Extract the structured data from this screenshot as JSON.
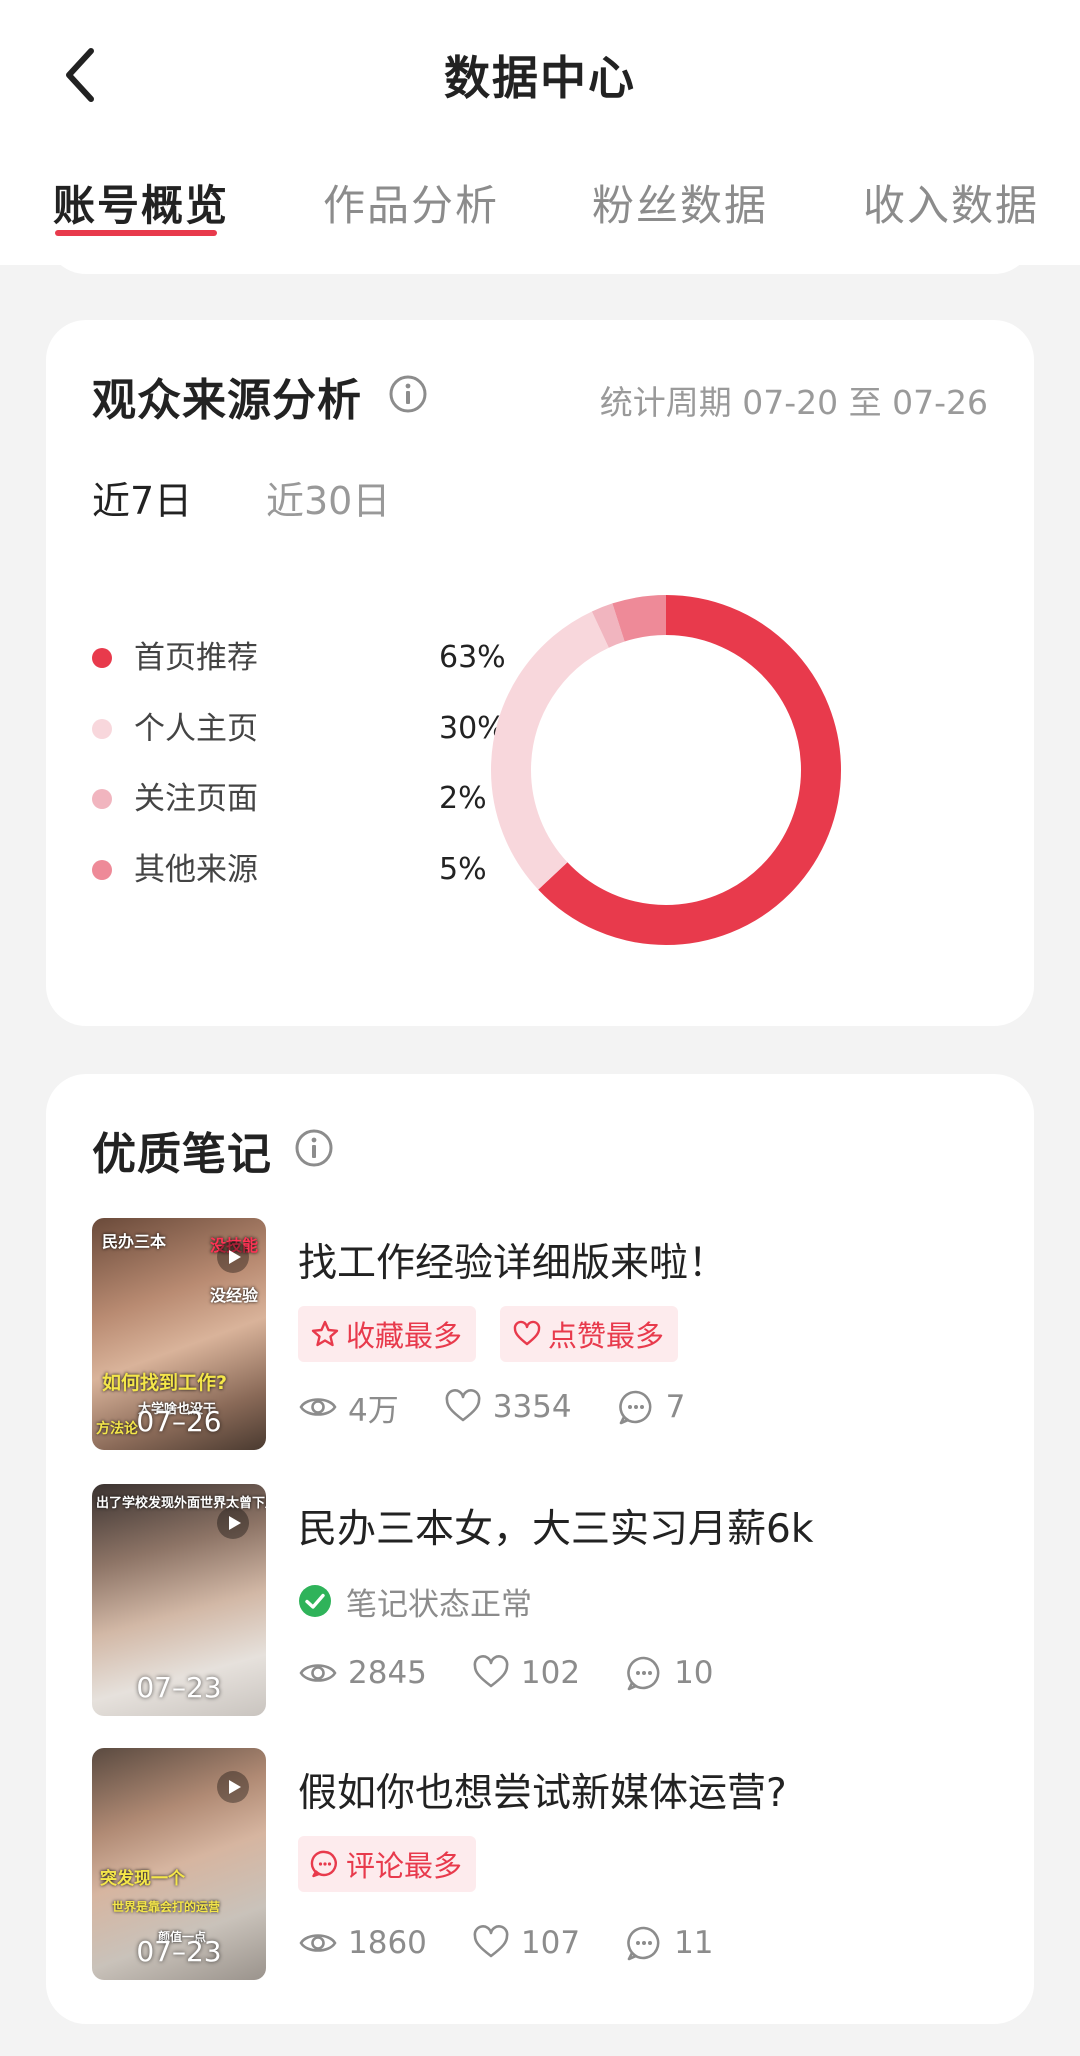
{
  "header": {
    "title": "数据中心",
    "back_icon": "chevron-left-icon"
  },
  "tabs": [
    {
      "label": "账号概览",
      "active": true
    },
    {
      "label": "作品分析",
      "active": false
    },
    {
      "label": "粉丝数据",
      "active": false
    },
    {
      "label": "收入数据",
      "active": false
    }
  ],
  "audience": {
    "title": "观众来源分析",
    "period": "统计周期 07-20 至 07-26",
    "range_tabs": [
      {
        "label": "近7日",
        "active": true
      },
      {
        "label": "近30日",
        "active": false
      }
    ],
    "legend": [
      {
        "label": "首页推荐",
        "value": "63%",
        "color": "#e83a4c"
      },
      {
        "label": "个人主页",
        "value": "30%",
        "color": "#f8d7dc"
      },
      {
        "label": "关注页面",
        "value": "2%",
        "color": "#f1b5bf"
      },
      {
        "label": "其他来源",
        "value": "5%",
        "color": "#ee8a98"
      }
    ]
  },
  "chart_data": {
    "type": "pie",
    "categories": [
      "首页推荐",
      "个人主页",
      "关注页面",
      "其他来源"
    ],
    "values": [
      63,
      30,
      2,
      5
    ],
    "colors": [
      "#e83a4c",
      "#f8d7dc",
      "#f1b5bf",
      "#ee8a98"
    ],
    "style": "donut"
  },
  "notes": {
    "title": "优质笔记",
    "items": [
      {
        "title": "找工作经验详细版来啦！",
        "date": "07–26",
        "badges": [
          {
            "label": "收藏最多",
            "icon": "star-icon"
          },
          {
            "label": "点赞最多",
            "icon": "heart-icon"
          }
        ],
        "views": "4万",
        "likes": "3354",
        "comments": "7",
        "thumb_texts": [
          "民办三本",
          "没技能",
          "没经验",
          "如何找到工作?",
          "大学啥也没干",
          "方法论"
        ]
      },
      {
        "title": "民办三本女，大三实习月薪6k",
        "date": "07–23",
        "status": "笔记状态正常",
        "views": "2845",
        "likes": "102",
        "comments": "10",
        "thumb_texts": [
          "出了学校发现外面世界太曾下周"
        ]
      },
      {
        "title": "假如你也想尝试新媒体运营?",
        "date": "07–23",
        "badges": [
          {
            "label": "评论最多",
            "icon": "comment-icon"
          }
        ],
        "views": "1860",
        "likes": "107",
        "comments": "11",
        "thumb_texts": [
          "突发现一个",
          "世界是靠会打的运营",
          "颜值一点"
        ]
      }
    ]
  },
  "colors": {
    "accent": "#e83a4c",
    "badge_bg": "#fdebed",
    "ok_green": "#2fb35a"
  }
}
